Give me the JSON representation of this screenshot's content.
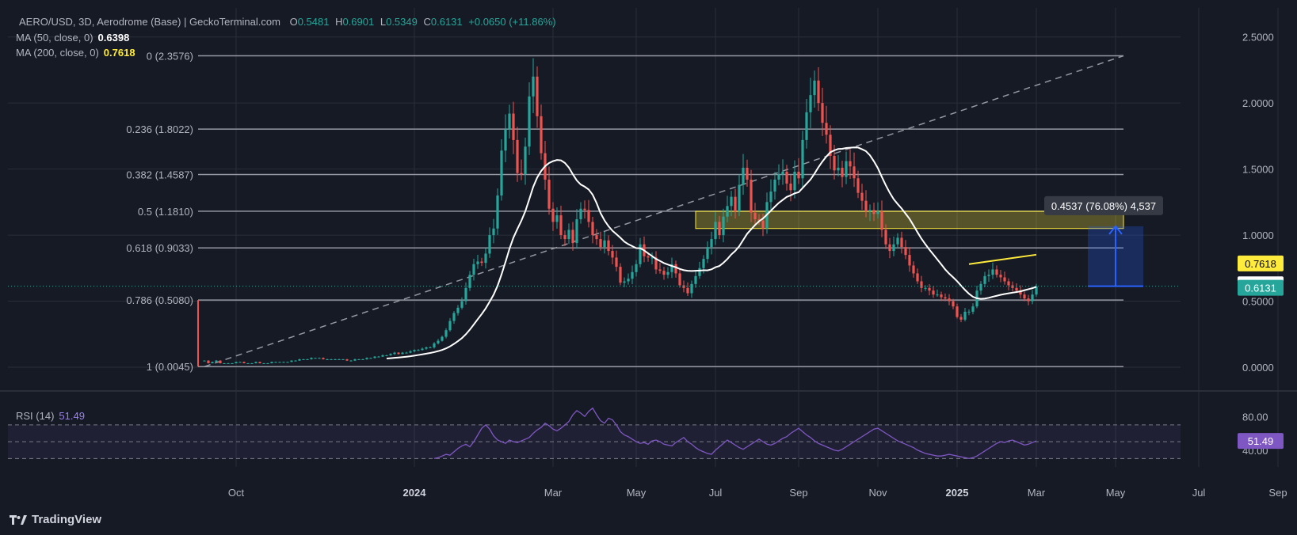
{
  "header": {
    "symbol": "AERO/USD, 3D, Aerodrome (Base) | GeckoTerminal.com",
    "o_label": "O",
    "o_value": "0.5481",
    "h_label": "H",
    "h_value": "0.6901",
    "l_label": "L",
    "l_value": "0.5349",
    "c_label": "C",
    "c_value": "0.6131",
    "change": "+0.0650 (+11.86%)"
  },
  "indicators": [
    {
      "label": "MA (50, close, 0)",
      "value": "0.6398",
      "color": "#ffffff"
    },
    {
      "label": "MA (200, close, 0)",
      "value": "0.7618",
      "color": "#ffeb3b"
    }
  ],
  "rsi": {
    "label": "RSI (14)",
    "value": "51.49",
    "color": "#9c7ff0"
  },
  "brand": "TradingView",
  "colors": {
    "up": "#26a69a",
    "down": "#ef5350",
    "bg": "#161a25",
    "grid": "#2a2e39",
    "fib": "#9598a1"
  },
  "chart_data": {
    "type": "candlestick",
    "symbol": "AERO/USD",
    "timeframe": "3D",
    "x_ticks": [
      "Oct",
      "2024",
      "Mar",
      "May",
      "Jul",
      "Sep",
      "Nov",
      "2025",
      "Mar",
      "May",
      "Jul",
      "Sep"
    ],
    "x_tick_index": [
      8,
      53,
      88,
      109,
      129,
      150,
      170,
      190,
      210,
      230,
      251,
      271
    ],
    "ylim": [
      -0.12,
      2.72
    ],
    "y_ticks": [
      "2.5000",
      "2.0000",
      "1.5000",
      "1.0000",
      "0.5000",
      "0.0000"
    ],
    "y_tick_values": [
      2.5,
      2.0,
      1.5,
      1.0,
      0.5,
      0.0
    ],
    "fib_levels": [
      {
        "label": "0 (2.3576)",
        "value": 2.3576
      },
      {
        "label": "0.236 (1.8022)",
        "value": 1.8022
      },
      {
        "label": "0.382 (1.4587)",
        "value": 1.4587
      },
      {
        "label": "0.5 (1.1810)",
        "value": 1.181
      },
      {
        "label": "0.618 (0.9033)",
        "value": 0.9033
      },
      {
        "label": "0.786 (0.5080)",
        "value": 0.508
      },
      {
        "label": "1 (0.0045)",
        "value": 0.0045
      }
    ],
    "close_series": [
      0.05,
      0.03,
      0.04,
      0.05,
      0.03,
      0.03,
      0.03,
      0.03,
      0.04,
      0.04,
      0.03,
      0.03,
      0.03,
      0.04,
      0.03,
      0.03,
      0.03,
      0.04,
      0.04,
      0.04,
      0.04,
      0.04,
      0.05,
      0.05,
      0.06,
      0.06,
      0.06,
      0.07,
      0.07,
      0.07,
      0.06,
      0.06,
      0.06,
      0.06,
      0.06,
      0.06,
      0.05,
      0.05,
      0.06,
      0.06,
      0.06,
      0.07,
      0.07,
      0.08,
      0.08,
      0.09,
      0.09,
      0.1,
      0.11,
      0.1,
      0.11,
      0.11,
      0.12,
      0.13,
      0.13,
      0.14,
      0.15,
      0.15,
      0.18,
      0.2,
      0.23,
      0.28,
      0.35,
      0.41,
      0.45,
      0.5,
      0.6,
      0.7,
      0.78,
      0.8,
      0.79,
      0.86,
      1.0,
      1.05,
      1.3,
      1.64,
      1.8,
      1.92,
      1.72,
      1.47,
      1.46,
      1.67,
      2.05,
      2.2,
      1.9,
      1.62,
      1.42,
      1.2,
      1.1,
      1.15,
      1.0,
      0.97,
      1.04,
      0.94,
      1.12,
      1.2,
      1.19,
      1.1,
      1.0,
      0.97,
      0.91,
      0.96,
      0.88,
      0.83,
      0.76,
      0.64,
      0.65,
      0.67,
      0.72,
      0.78,
      0.93,
      0.84,
      0.83,
      0.83,
      0.74,
      0.73,
      0.7,
      0.72,
      0.78,
      0.71,
      0.62,
      0.6,
      0.56,
      0.63,
      0.69,
      0.75,
      0.82,
      0.91,
      0.97,
      1.1,
      1.0,
      1.14,
      1.22,
      1.29,
      1.18,
      1.38,
      1.51,
      1.42,
      1.17,
      1.12,
      1.11,
      1.05,
      1.25,
      1.33,
      1.42,
      1.46,
      1.48,
      1.39,
      1.34,
      1.48,
      1.43,
      1.72,
      1.93,
      2.06,
      2.17,
      2.0,
      1.85,
      1.76,
      1.6,
      1.49,
      1.51,
      1.44,
      1.56,
      1.52,
      1.43,
      1.32,
      1.26,
      1.18,
      1.19,
      1.16,
      1.18,
      1.04,
      0.93,
      0.88,
      0.93,
      0.98,
      0.91,
      0.85,
      0.77,
      0.71,
      0.65,
      0.6,
      0.6,
      0.58,
      0.55,
      0.55,
      0.53,
      0.52,
      0.5,
      0.46,
      0.38,
      0.36,
      0.42,
      0.42,
      0.46,
      0.58,
      0.63,
      0.69,
      0.7,
      0.74,
      0.7,
      0.68,
      0.65,
      0.62,
      0.6,
      0.58,
      0.55,
      0.52,
      0.5,
      0.55,
      0.61
    ],
    "ma50": {
      "name": "MA (50, close, 0)",
      "last": 0.6398,
      "start_index": 46
    },
    "ma200": {
      "name": "MA (200, close, 0)",
      "last": 0.7618,
      "start_index": 188
    },
    "last_close": 0.6131,
    "price_labels": [
      {
        "text": "0.7618",
        "value": 0.7618,
        "bg": "#ffeb3b",
        "fg": "#000000"
      },
      {
        "text": "0.6398",
        "value": 0.6398,
        "bg": "#ffffff",
        "fg": "#000000"
      },
      {
        "text": "0.6131",
        "value": 0.6131,
        "bg": "#26a69a",
        "fg": "#ffffff"
      }
    ],
    "zone": {
      "from": 1.05,
      "to": 1.18
    },
    "measure": {
      "from": 0.6131,
      "to": 1.0668,
      "label": "0.4537 (76.08%) 4,537"
    },
    "rsi_ylim": [
      20,
      100
    ],
    "rsi_ticks": [
      "80.00",
      "40.00"
    ],
    "rsi_tick_values": [
      80,
      40
    ],
    "rsi_bands": [
      70,
      50,
      30
    ],
    "rsi_series": [
      30,
      31,
      33,
      35,
      34,
      38,
      42,
      45,
      47,
      44,
      50,
      58,
      66,
      70,
      65,
      57,
      52,
      50,
      48,
      52,
      50,
      49,
      51,
      53,
      55,
      60,
      64,
      67,
      72,
      69,
      65,
      63,
      66,
      70,
      74,
      82,
      87,
      84,
      80,
      86,
      90,
      82,
      75,
      72,
      78,
      76,
      70,
      62,
      58,
      56,
      53,
      50,
      48,
      49,
      47,
      51,
      52,
      50,
      47,
      46,
      45,
      49,
      52,
      55,
      50,
      47,
      43,
      40,
      38,
      36,
      35,
      40,
      44,
      48,
      52,
      49,
      46,
      43,
      41,
      44,
      47,
      50,
      53,
      50,
      47,
      46,
      48,
      51,
      54,
      56,
      60,
      63,
      66,
      62,
      58,
      55,
      51,
      48,
      46,
      44,
      42,
      40,
      39,
      41,
      44,
      47,
      50,
      53,
      56,
      59,
      62,
      65,
      66,
      63,
      60,
      57,
      54,
      51,
      49,
      47,
      45,
      43,
      40,
      38,
      36,
      35,
      34,
      33,
      33,
      34,
      35,
      34,
      33,
      32,
      31,
      30,
      31,
      33,
      36,
      39,
      42,
      45,
      48,
      50,
      49,
      51,
      52,
      50,
      48,
      46,
      47,
      49,
      51
    ],
    "rsi_start_index": 100
  }
}
